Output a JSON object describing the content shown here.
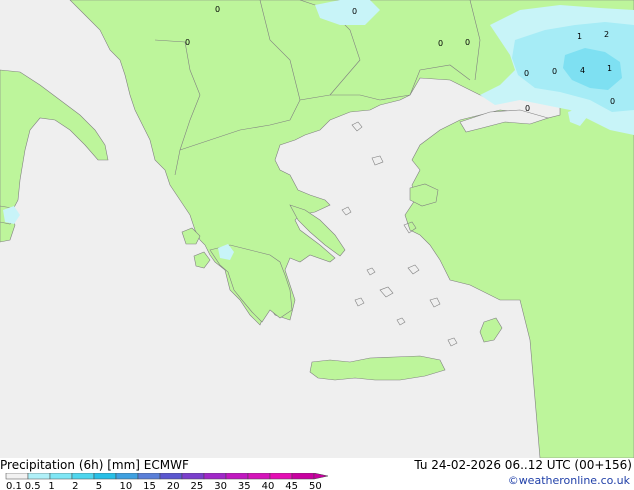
{
  "map": {
    "cell_labels": [
      "0",
      "0",
      "0",
      "0",
      "1",
      "2",
      "0",
      "0",
      "4",
      "1",
      "0",
      "0",
      "0"
    ]
  },
  "footer": {
    "title": "Precipitation (6h) [mm] ECMWF",
    "valid_time": "Tu 24-02-2026 06..12 UTC (00+156)",
    "credit": "©weatheronline.co.uk"
  },
  "legend": {
    "ticks": [
      "0.1",
      "0.5",
      "1",
      "2",
      "5",
      "10",
      "15",
      "20",
      "25",
      "30",
      "35",
      "40",
      "45",
      "50"
    ],
    "colors": [
      "#f2f2f2",
      "#b0f0f8",
      "#7fe6f5",
      "#4fd6ee",
      "#28bfe6",
      "#3fa0e0",
      "#5a7fd8",
      "#5b57cf",
      "#7a3fcc",
      "#a028c8",
      "#c018c0",
      "#d414ba",
      "#e40eb4",
      "#c800a0"
    ]
  },
  "colors": {
    "sea": "#efefef",
    "land": "#bdf59b",
    "border": "#808080",
    "rain_light": "#c8f4f8",
    "rain_mid": "#a6ecf6",
    "rain_heavy": "#7ee0f2"
  }
}
